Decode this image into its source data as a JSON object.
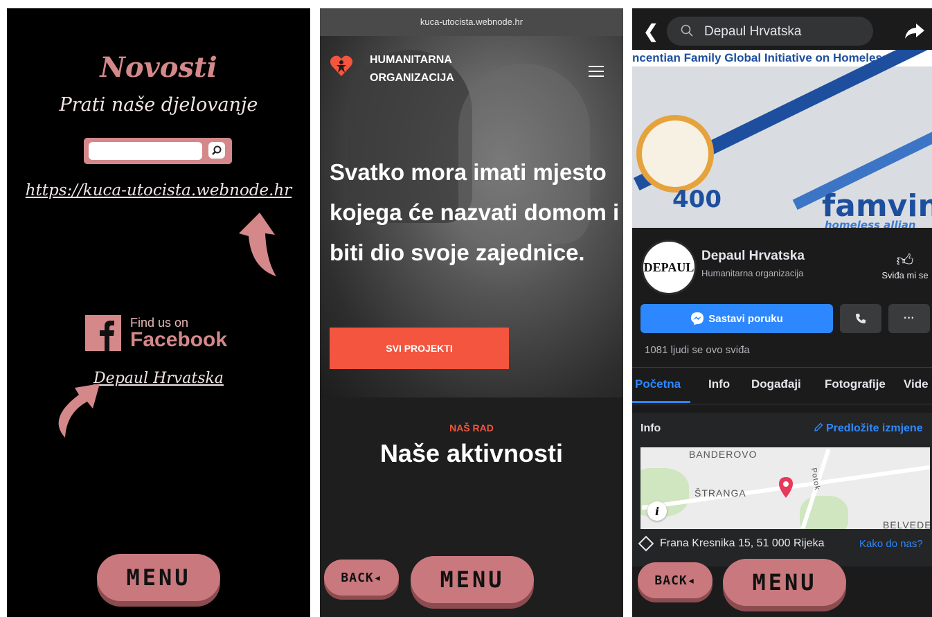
{
  "panel1": {
    "title": "Novosti",
    "subtitle": "Prati naše djelovanje",
    "search": {
      "value": "",
      "placeholder": ""
    },
    "website_link": "https://kuca-utocista.webnode.hr",
    "facebook_badge": {
      "line1": "Find us on",
      "line2": "Facebook"
    },
    "facebook_link": "Depaul Hrvatska",
    "menu_label": "MENU"
  },
  "panel2": {
    "url": "kuca-utocista.webnode.hr",
    "org_line1": "HUMANITARNA",
    "org_line2": "ORGANIZACIJA",
    "slogan": "Svatko mora imati mjesto kojega će nazvati domom i biti dio svoje zajednice.",
    "cta": "SVI PROJEKTI",
    "section_kicker": "NAŠ RAD",
    "section_title": "Naše aktivnosti",
    "back_label": "BACK◂",
    "menu_label": "MENU"
  },
  "panel3": {
    "search_value": "Depaul Hrvatska",
    "cover_band": "ncentian Family Global Initiative on Homelessn",
    "cover_year": "400",
    "cover_brand": "famvin",
    "cover_brand_sub": "homeless allian",
    "avatar_text": "DEPAUL",
    "page_name": "Depaul Hrvatska",
    "page_category": "Humanitarna organizacija",
    "like_label": "Sviđa mi se",
    "message_button": "Sastavi poruku",
    "likes_count": "1081 ljudi se ovo sviđa",
    "tabs": [
      "Početna",
      "Info",
      "Događaji",
      "Fotografije",
      "Vide"
    ],
    "info_label": "Info",
    "suggest_label": "Predložite izmjene",
    "map_labels": [
      "BANDEROVO",
      "ŠTRANGA",
      "Potok",
      "BELVEDER"
    ],
    "address": "Frana Kresnika 15, 51 000 Rijeka",
    "route_link": "Kako do nas?",
    "back_label": "BACK◂",
    "menu_label": "MENU"
  },
  "colors": {
    "accent_pink": "#d4888a",
    "cta_orange": "#f4553e",
    "facebook_blue": "#2d88ff"
  }
}
